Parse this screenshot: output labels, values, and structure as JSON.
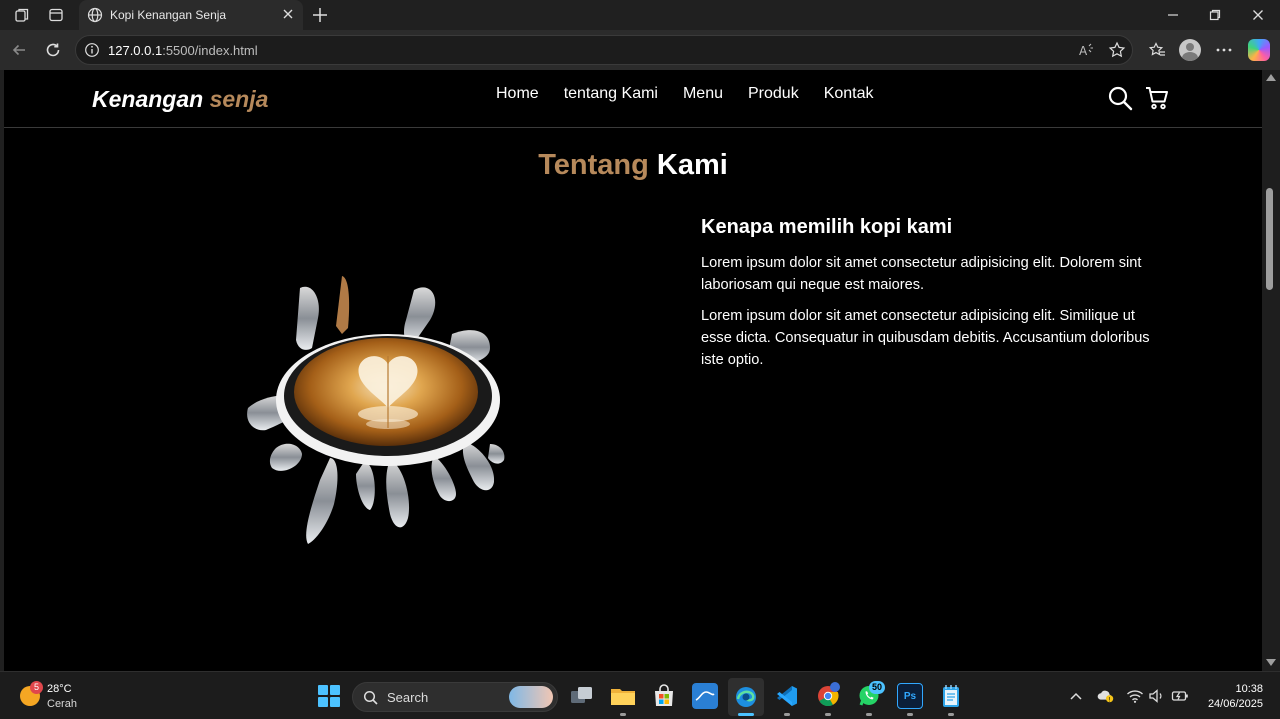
{
  "browser": {
    "tab_title": "Kopi Kenangan Senja",
    "url_host": "127.0.0.1",
    "url_path": ":5500/index.html"
  },
  "site": {
    "logo_main": "Kenangan ",
    "logo_accent": "senja",
    "nav_items": [
      "Home",
      "tentang Kami",
      "Menu",
      "Produk",
      "Kontak"
    ],
    "accent_color": "#b6895b"
  },
  "about": {
    "title_accent": "Tentang",
    "title_rest": " Kami",
    "heading": "Kenapa memilih kopi kami",
    "paragraphs": [
      "Lorem ipsum dolor sit amet consectetur adipisicing elit. Dolorem sint laboriosam qui neque est maiores.",
      "Lorem ipsum dolor sit amet consectetur adipisicing elit. Similique ut esse dicta. Consequatur in quibusdam debitis. Accusantium doloribus iste optio."
    ]
  },
  "taskbar": {
    "weather_badge": "5",
    "weather_temp": "28°C",
    "weather_desc": "Cerah",
    "search_label": "Search",
    "whatsapp_badge": "50",
    "time": "10:38",
    "date": "24/06/2025"
  }
}
